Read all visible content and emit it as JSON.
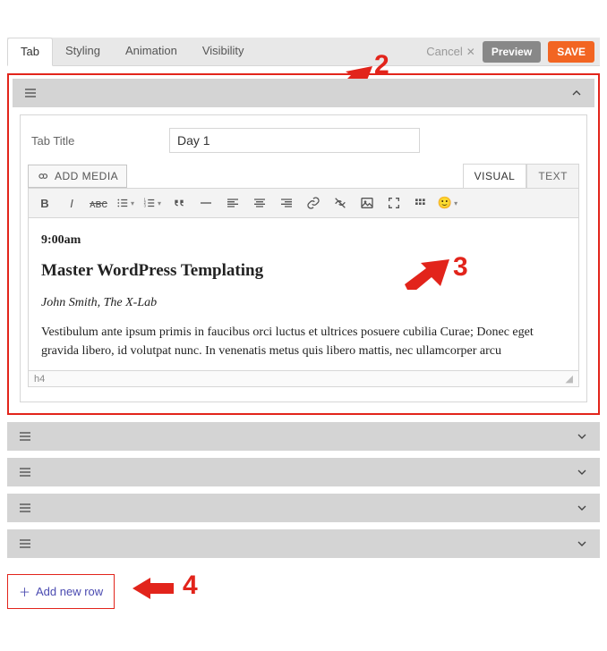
{
  "top_tabs": {
    "items": [
      "Tab",
      "Styling",
      "Animation",
      "Visibility"
    ],
    "active_index": 0
  },
  "actions": {
    "cancel": "Cancel",
    "preview": "Preview",
    "save": "SAVE"
  },
  "field": {
    "label": "Tab Title",
    "value": "Day 1"
  },
  "editor": {
    "add_media": "ADD MEDIA",
    "tabs": {
      "visual": "VISUAL",
      "text": "TEXT",
      "active": "visual"
    },
    "status_path": "h4",
    "content": {
      "time": "9:00am",
      "title": "Master WordPress Templating",
      "byline": "John Smith, The X-Lab",
      "para": "Vestibulum ante ipsum primis in faucibus orci luctus et ultrices posuere cubilia Curae; Donec eget gravida libero, id volutpat nunc. In venenatis metus quis libero mattis, nec ullamcorper arcu"
    }
  },
  "add_row_label": "Add new row",
  "annotations": {
    "n2": "2",
    "n3": "3",
    "n4": "4"
  }
}
